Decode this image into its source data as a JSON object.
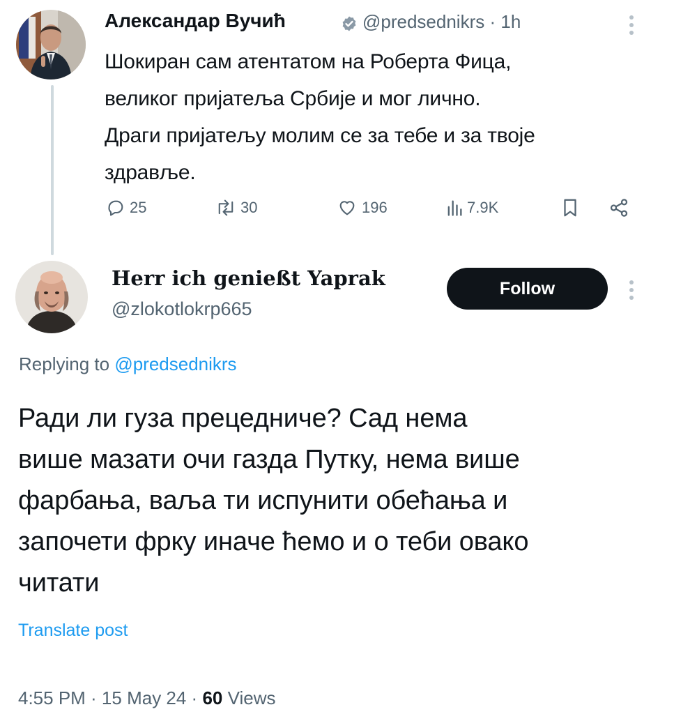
{
  "parent_tweet": {
    "author_name": "Александар Вучић",
    "handle": "@predsednikrs",
    "time": "· 1h",
    "text_lines": [
      "Шокиран сам атентатом на Роберта Фица,",
      "великог пријатеља Србије и мог лично.",
      "Драги пријатељу молим се за тебе и за твоје",
      "здравље."
    ],
    "actions": {
      "replies": "25",
      "reposts": "30",
      "likes": "196",
      "views": "7.9K"
    },
    "icons": {
      "verified": "verified-badge-icon",
      "more": "more-vertical-icon",
      "reply": "reply-icon",
      "repost": "repost-icon",
      "like": "heart-icon",
      "views": "views-chart-icon",
      "bookmark": "bookmark-icon",
      "share": "share-icon"
    }
  },
  "reply_tweet": {
    "author_name": "Herr ich genießt Yaprak",
    "handle": "@zlokotlokrp665",
    "follow_label": "Follow",
    "replying_prefix": "Replying to",
    "replying_handle": "@predsednikrs",
    "text_lines": [
      "Ради ли гуза прецедниче? Сад нема",
      "више мазати очи газда Путку, нема више",
      "фарбања, ваља ти испунити обећања и",
      "започети фрку иначе ћемо и о теби овако",
      "читати"
    ],
    "translate_label": "Translate post",
    "timestamp": "4:55 PM · 15 May 24 ·",
    "views_count": "60",
    "views_label": "Views"
  },
  "colors": {
    "text_primary": "#0f1419",
    "text_secondary": "#536471",
    "link": "#1d9bf0",
    "verified_badge": "#8a99a6",
    "follow_bg": "#0f1419",
    "follow_text": "#ffffff",
    "thread_line": "#cfd9de"
  }
}
